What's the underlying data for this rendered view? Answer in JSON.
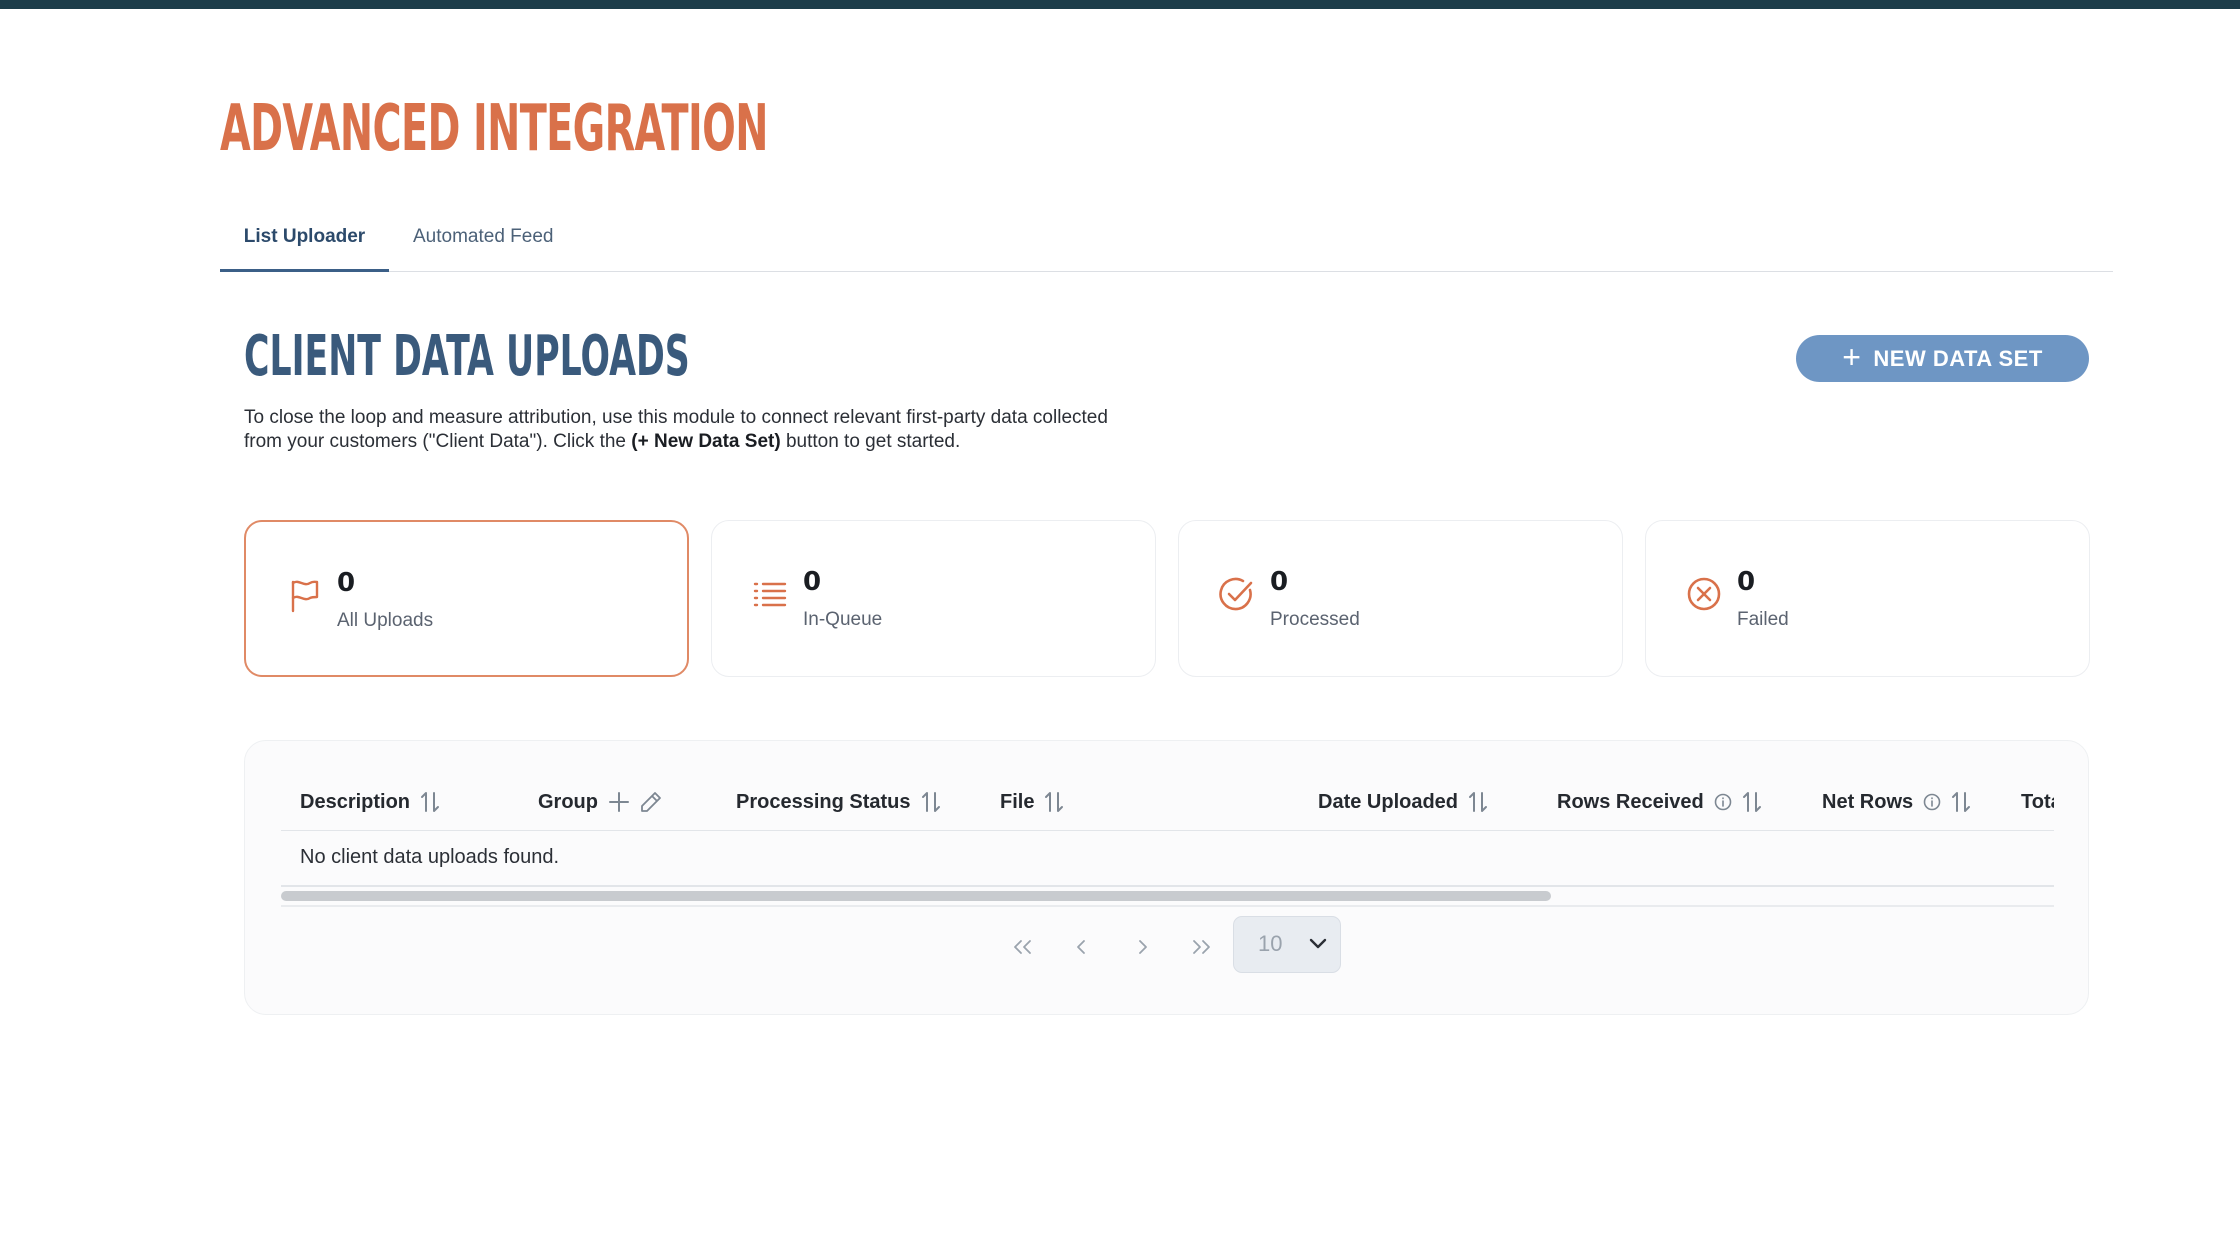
{
  "page": {
    "title": "Advanced Integration"
  },
  "tabs": [
    {
      "label": "List Uploader",
      "active": true
    },
    {
      "label": "Automated Feed",
      "active": false
    }
  ],
  "section": {
    "title": "Client Data Uploads",
    "new_button_label": "NEW DATA SET",
    "description_part1": "To close the loop and measure attribution, use this module to connect relevant first-party data collected from your customers (\"Client Data\"). Click the ",
    "description_bold": "(+ New Data Set)",
    "description_part2": " button to get started."
  },
  "cards": [
    {
      "count": "0",
      "label": "All Uploads",
      "icon": "flag-icon",
      "active": true
    },
    {
      "count": "0",
      "label": "In-Queue",
      "icon": "list-icon",
      "active": false
    },
    {
      "count": "0",
      "label": "Processed",
      "icon": "check-circle-icon",
      "active": false
    },
    {
      "count": "0",
      "label": "Failed",
      "icon": "x-circle-icon",
      "active": false
    }
  ],
  "table": {
    "columns": [
      {
        "label": "Description"
      },
      {
        "label": "Group"
      },
      {
        "label": "Processing Status"
      },
      {
        "label": "File"
      },
      {
        "label": "Date Uploaded"
      },
      {
        "label": "Rows Received"
      },
      {
        "label": "Net Rows"
      },
      {
        "label": "Tota"
      }
    ],
    "empty_message": "No client data uploads found."
  },
  "pagination": {
    "page_size": "10"
  },
  "colors": {
    "accent_orange": "#d9714a",
    "heading_blue": "#3a5a7c",
    "button_blue": "#6e96c4",
    "top_bar": "#1d3d4a"
  }
}
